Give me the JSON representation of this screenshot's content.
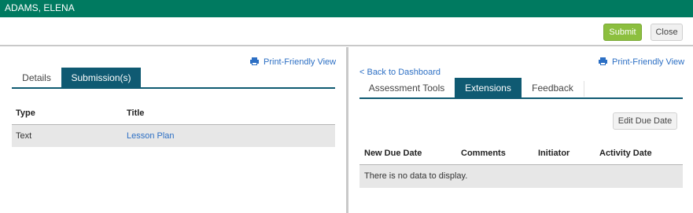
{
  "header": {
    "student_name": "ADAMS, ELENA"
  },
  "actions": {
    "submit_label": "Submit",
    "close_label": "Close"
  },
  "left_panel": {
    "print_label": "Print-Friendly View",
    "tabs": [
      {
        "label": "Details"
      },
      {
        "label": "Submission(s)"
      }
    ],
    "table": {
      "columns": [
        "Type",
        "Title"
      ],
      "rows": [
        {
          "type": "Text",
          "title": "Lesson Plan"
        }
      ]
    }
  },
  "right_panel": {
    "print_label": "Print-Friendly View",
    "back_label": "< Back to Dashboard",
    "tabs": [
      {
        "label": "Assessment Tools"
      },
      {
        "label": "Extensions"
      },
      {
        "label": "Feedback"
      }
    ],
    "edit_due_date_label": "Edit Due Date",
    "table": {
      "columns": [
        "New Due Date",
        "Comments",
        "Initiator",
        "Activity Date"
      ],
      "empty_message": "There is no data to display."
    }
  },
  "colors": {
    "brand_green": "#007a60",
    "tab_active": "#0f5a72",
    "submit_green": "#8cbf3f",
    "link_blue": "#2c6fc4"
  }
}
